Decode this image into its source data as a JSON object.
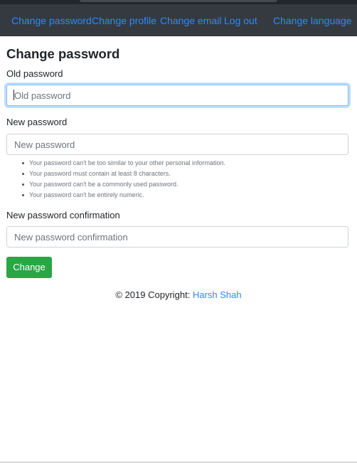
{
  "navbar": {
    "links": [
      "Change password",
      "Change profile",
      "Change email",
      "Log out",
      "Change language"
    ]
  },
  "main": {
    "title": "Change password",
    "old_password": {
      "label": "Old password",
      "placeholder": "Old password",
      "value": ""
    },
    "new_password": {
      "label": "New password",
      "placeholder": "New password",
      "value": "",
      "help": [
        "Your password can't be too similar to your other personal information.",
        "Your password must contain at least 8 characters.",
        "Your password can't be a commonly used password.",
        "Your password can't be entirely numeric."
      ]
    },
    "confirm_password": {
      "label": "New password confirmation",
      "placeholder": "New password confirmation",
      "value": ""
    },
    "submit_label": "Change"
  },
  "footer": {
    "text": "© 2019 Copyright: ",
    "author": "Harsh Shah"
  },
  "colors": {
    "navbar_bg": "#343a40",
    "link": "#2b8bff",
    "submit": "#28a745",
    "focus_border": "#80bdff"
  }
}
